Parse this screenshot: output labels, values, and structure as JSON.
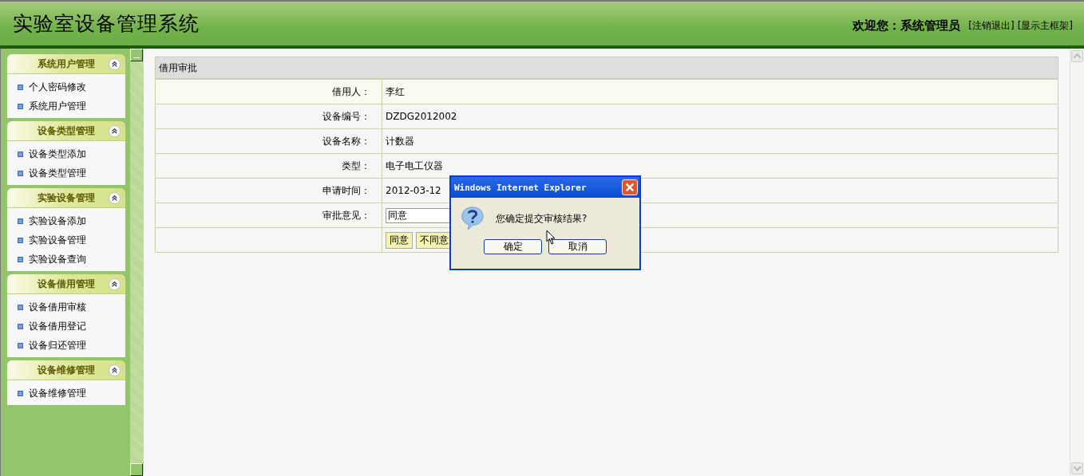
{
  "header": {
    "title": "实验室设备管理系统",
    "welcome": "欢迎您：系统管理员",
    "links": [
      "[注销退出]",
      "[显示主框架]"
    ]
  },
  "sidebar": {
    "groups": [
      {
        "title": "系统用户管理",
        "expanded": true,
        "items": [
          "个人密码修改",
          "系统用户管理"
        ]
      },
      {
        "title": "设备类型管理",
        "expanded": true,
        "items": [
          "设备类型添加",
          "设备类型管理"
        ]
      },
      {
        "title": "实验设备管理",
        "expanded": true,
        "items": [
          "实验设备添加",
          "实验设备管理",
          "实验设备查询"
        ]
      },
      {
        "title": "设备借用管理",
        "expanded": true,
        "items": [
          "设备借用审核",
          "设备借用登记",
          "设备归还管理"
        ]
      },
      {
        "title": "设备维修管理",
        "expanded": true,
        "items": [
          "设备维修管理"
        ]
      }
    ]
  },
  "form": {
    "title": "借用审批",
    "rows": [
      {
        "kind": "text",
        "label": "借用人：",
        "value": "李红"
      },
      {
        "kind": "text",
        "label": "设备编号：",
        "value": "DZDG2012002"
      },
      {
        "kind": "text",
        "label": "设备名称：",
        "value": "计数器"
      },
      {
        "kind": "text",
        "label": "类型：",
        "value": "电子电工仪器"
      },
      {
        "kind": "text",
        "label": "申请时间：",
        "value": "2012-03-12"
      },
      {
        "kind": "select",
        "label": "审批意见：",
        "value": "同意"
      },
      {
        "kind": "buttons",
        "buttons": [
          "同意",
          "不同意"
        ]
      }
    ]
  },
  "dialog": {
    "title": "Windows Internet Explorer",
    "message": "您确定提交审核结果?",
    "buttons": [
      "确定",
      "取消"
    ]
  }
}
